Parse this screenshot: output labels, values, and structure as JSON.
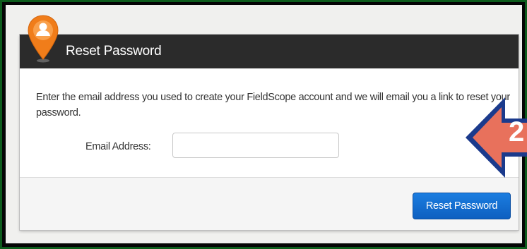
{
  "dialog": {
    "title": "Reset Password",
    "instructions": "Enter the email address you used to create your FieldScope account and we will email you a link to reset your password.",
    "email_label": "Email Address:",
    "email_value": "",
    "email_placeholder": "",
    "submit_label": "Reset Password",
    "logo_icon": "location-pin-user-icon"
  },
  "annotation": {
    "step_number": "2",
    "arrow_icon": "left-arrow-icon"
  },
  "colors": {
    "header_bg": "#2b2b2b",
    "pin_orange": "#f07d1a",
    "button_blue": "#1b7de0",
    "callout_fill": "#e8715c",
    "callout_border": "#1b3a8c",
    "frame_green": "#0d5c1c"
  }
}
